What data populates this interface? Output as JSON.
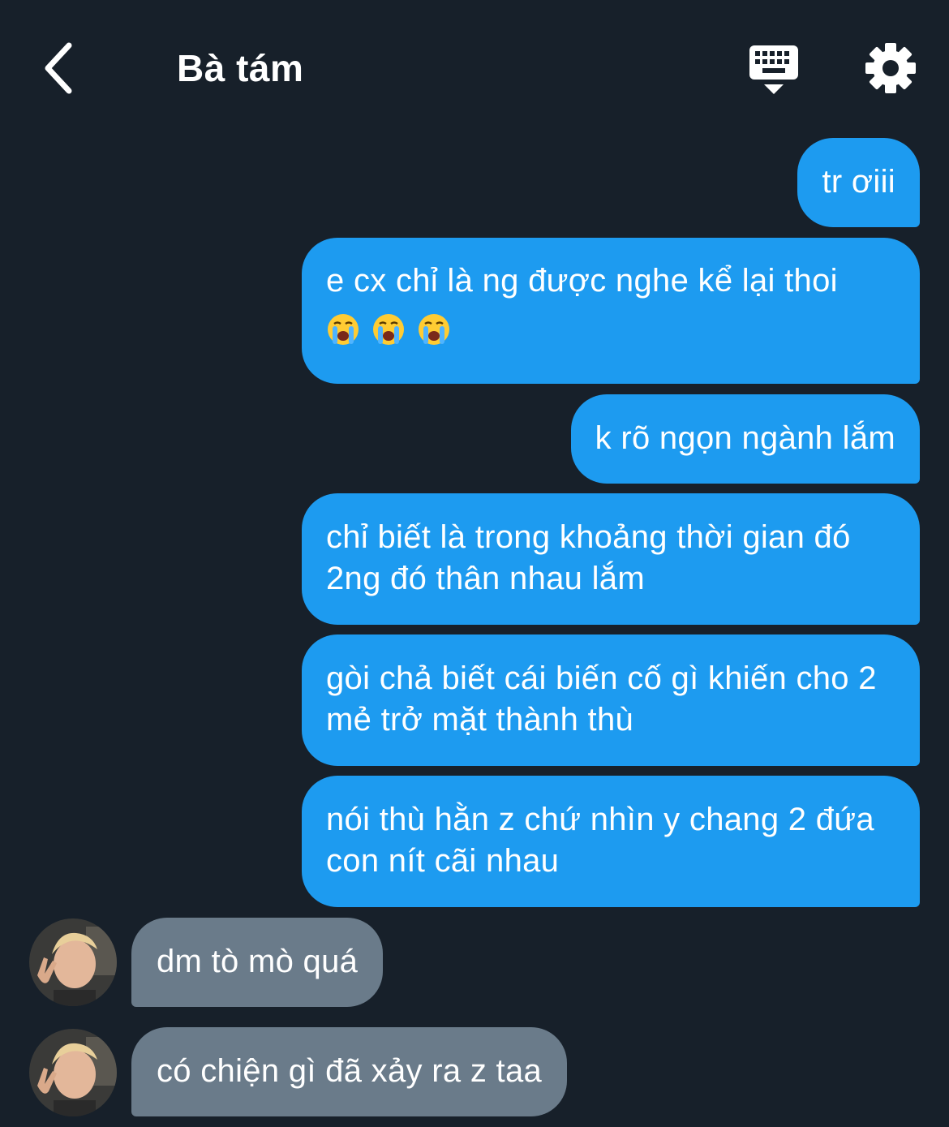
{
  "header": {
    "title": "Bà tám",
    "back_icon": "chevron-left-icon",
    "keyboard_icon": "keyboard-hide-icon",
    "settings_icon": "gear-icon"
  },
  "colors": {
    "background": "#17202a",
    "outgoing_bubble": "#1d9bf0",
    "incoming_bubble": "#6a7b8a"
  },
  "messages": [
    {
      "sender": "me",
      "text": "tr ơiii"
    },
    {
      "sender": "me",
      "text": "e cx chỉ là ng được nghe kể lại thoi",
      "emoji": [
        "crying-face-emoji",
        "crying-face-emoji",
        "crying-face-emoji"
      ]
    },
    {
      "sender": "me",
      "text": "k rõ ngọn ngành lắm"
    },
    {
      "sender": "me",
      "text": "chỉ biết là trong khoảng thời gian đó 2ng đó thân nhau lắm"
    },
    {
      "sender": "me",
      "text": "gòi chả biết cái biến cố gì khiến cho 2 mẻ trở mặt thành thù"
    },
    {
      "sender": "me",
      "text": "nói thù hằn z chứ nhìn y chang 2 đứa con nít cãi nhau"
    },
    {
      "sender": "them",
      "text": "dm tò mò quá"
    },
    {
      "sender": "them",
      "text": "có chiện gì đã xảy ra z taa"
    }
  ]
}
